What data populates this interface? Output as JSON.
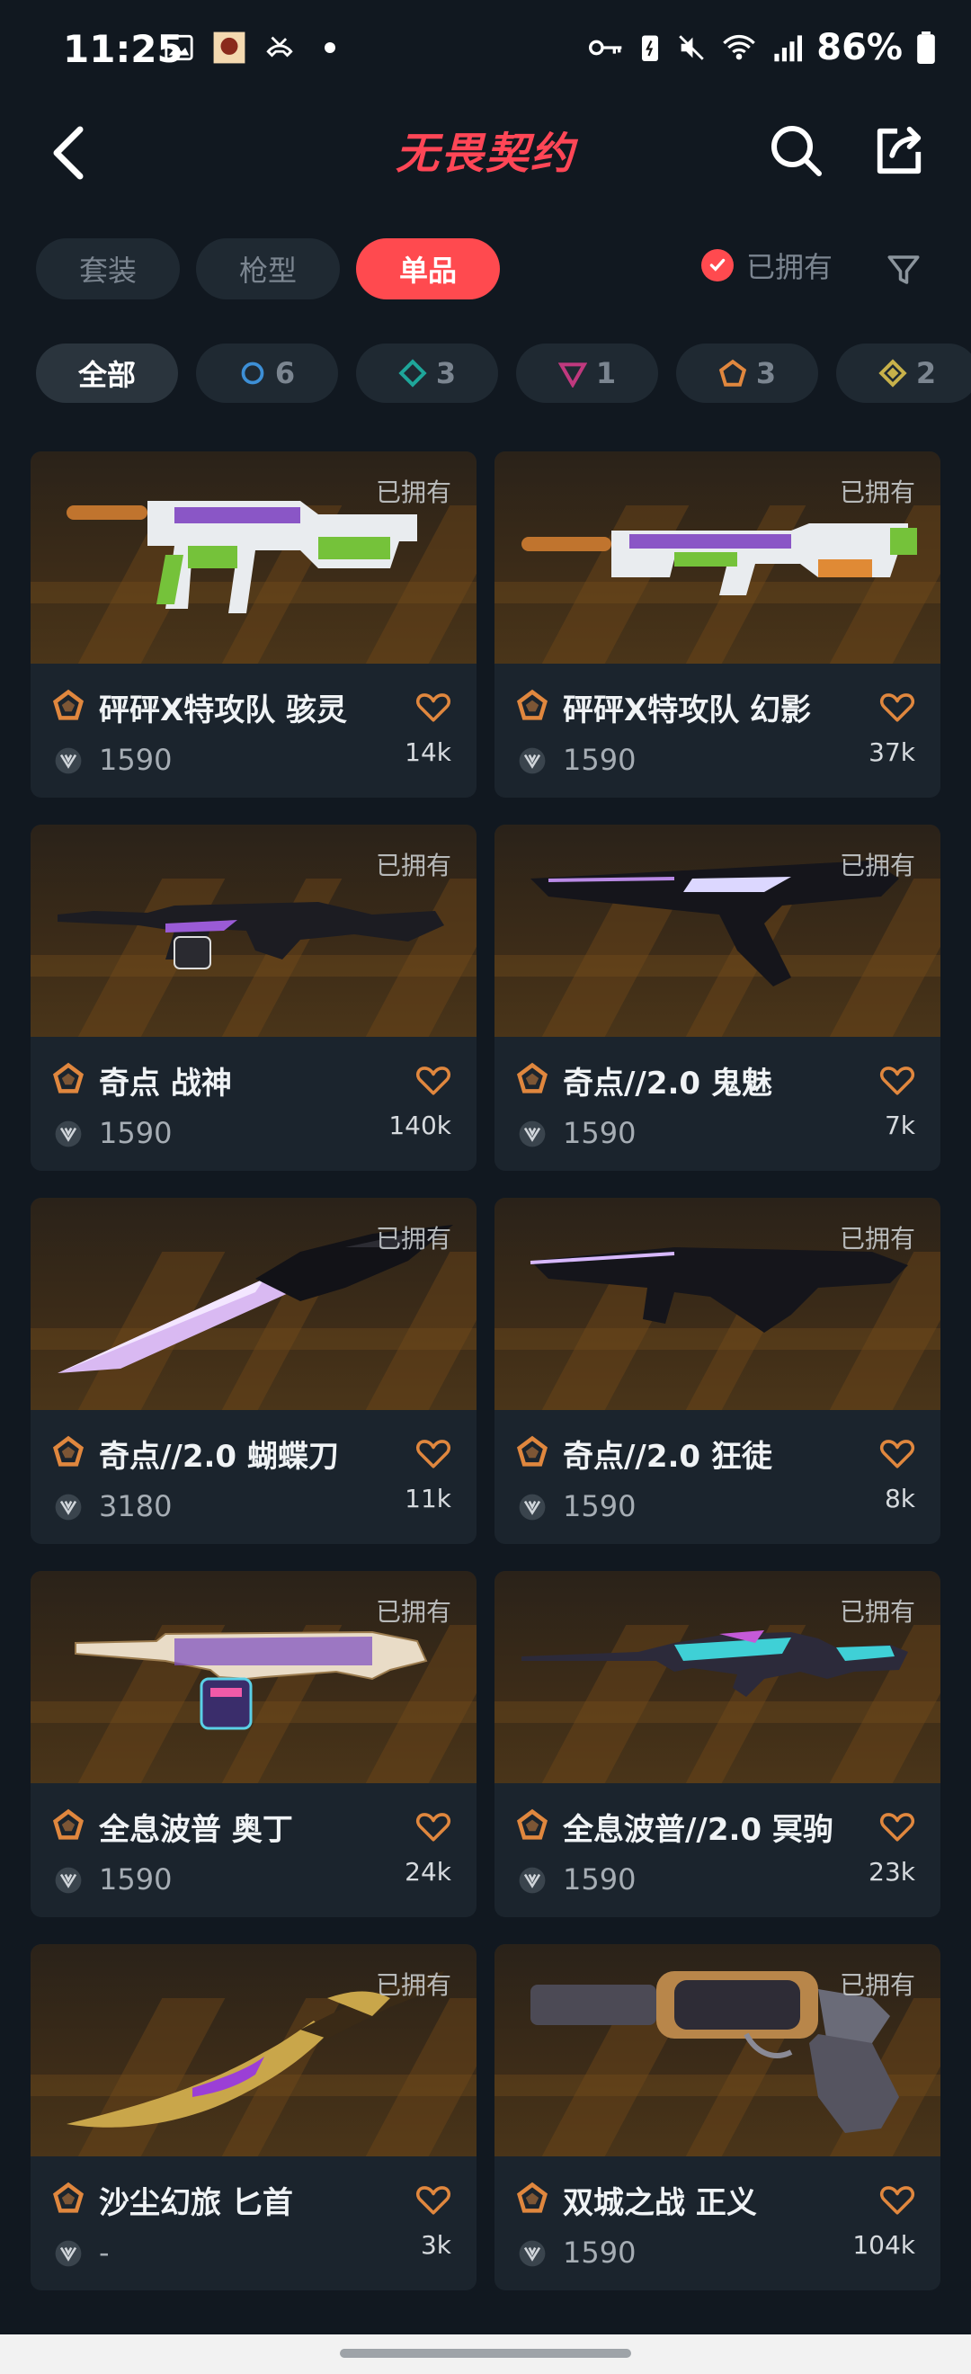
{
  "status": {
    "time": "11:25",
    "battery": "86%"
  },
  "header": {
    "title": "无畏契约"
  },
  "tabs": [
    {
      "label": "套装"
    },
    {
      "label": "枪型"
    },
    {
      "label": "单品"
    }
  ],
  "owned_filter": {
    "label": "已拥有"
  },
  "chips": [
    {
      "label": "全部",
      "count": ""
    },
    {
      "label": "",
      "count": "6",
      "color": "#3d8fd6"
    },
    {
      "label": "",
      "count": "3",
      "color": "#1ea69a"
    },
    {
      "label": "",
      "count": "1",
      "color": "#c0397e"
    },
    {
      "label": "",
      "count": "3",
      "color": "#e0873e"
    },
    {
      "label": "",
      "count": "2",
      "color": "#c7b14a"
    }
  ],
  "colors": {
    "accent": "#ff4a4f",
    "tier_orange": "#e0873e",
    "background": "#111820",
    "card": "#1b242d"
  },
  "items": [
    {
      "owned": "已拥有",
      "name": "砰砰X特攻队 骇灵",
      "price": "1590",
      "likes": "14k",
      "weapon": "smg"
    },
    {
      "owned": "已拥有",
      "name": "砰砰X特攻队 幻影",
      "price": "1590",
      "likes": "37k",
      "weapon": "rifle"
    },
    {
      "owned": "已拥有",
      "name": "奇点 战神",
      "price": "1590",
      "likes": "140k",
      "weapon": "mg"
    },
    {
      "owned": "已拥有",
      "name": "奇点//2.0 鬼魅",
      "price": "1590",
      "likes": "7k",
      "weapon": "pistol"
    },
    {
      "owned": "已拥有",
      "name": "奇点//2.0 蝴蝶刀",
      "price": "3180",
      "likes": "11k",
      "weapon": "knife"
    },
    {
      "owned": "已拥有",
      "name": "奇点//2.0 狂徒",
      "price": "1590",
      "likes": "8k",
      "weapon": "rifle2"
    },
    {
      "owned": "已拥有",
      "name": "全息波普 奥丁",
      "price": "1590",
      "likes": "24k",
      "weapon": "odin"
    },
    {
      "owned": "已拥有",
      "name": "全息波普//2.0 冥驹",
      "price": "1590",
      "likes": "23k",
      "weapon": "sniper"
    },
    {
      "owned": "已拥有",
      "name": "沙尘幻旅 匕首",
      "price": "-",
      "likes": "3k",
      "weapon": "dagger"
    },
    {
      "owned": "已拥有",
      "name": "双城之战 正义",
      "price": "1590",
      "likes": "104k",
      "weapon": "revolver"
    }
  ]
}
